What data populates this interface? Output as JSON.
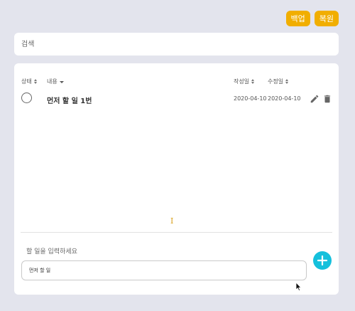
{
  "header": {
    "backup_label": "백업",
    "restore_label": "복원"
  },
  "search": {
    "placeholder": "검색",
    "value": ""
  },
  "table": {
    "columns": {
      "status": "상태",
      "content": "내용",
      "created": "작성일",
      "modified": "수정일"
    },
    "rows": [
      {
        "text": "먼저 할 일 1번",
        "created": "2020-04-10",
        "modified": "2020-04-10",
        "done": false
      }
    ]
  },
  "cursor_glyph": "I",
  "new_todo": {
    "label": "할 일을 입력하세요",
    "value": "먼저 할 일"
  },
  "colors": {
    "accent_yellow": "#f1ae00",
    "accent_cyan": "#15c0dc",
    "background": "#e3e4ed"
  },
  "icons": [
    "sort-icon",
    "caret-down-icon",
    "pencil-icon",
    "trash-icon",
    "plus-icon",
    "mouse-pointer-icon"
  ]
}
